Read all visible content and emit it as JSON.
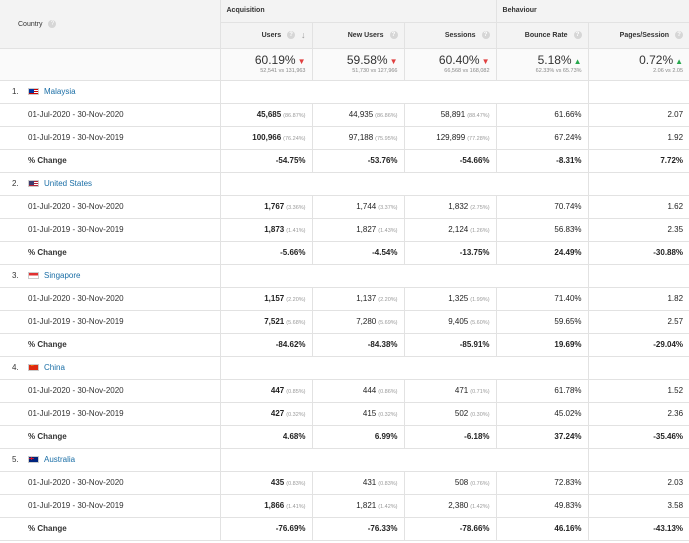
{
  "header": {
    "country_label": "Country",
    "group_acquisition": "Acquisition",
    "group_behaviour": "Behaviour",
    "columns": [
      "Users",
      "New Users",
      "Sessions",
      "Bounce Rate",
      "Pages/Session"
    ]
  },
  "totals": [
    {
      "pct": "60.19%",
      "dir": "down",
      "cmp": "52,541 vs 131,963"
    },
    {
      "pct": "59.58%",
      "dir": "down",
      "cmp": "51,730 vs 127,966"
    },
    {
      "pct": "60.40%",
      "dir": "down",
      "cmp": "66,568 vs 168,082"
    },
    {
      "pct": "5.18%",
      "dir": "up",
      "cmp": "62.33% vs 65.73%"
    },
    {
      "pct": "0.72%",
      "dir": "up",
      "cmp": "2.06 vs 2.05"
    }
  ],
  "rows": [
    {
      "index": "1.",
      "country": "Malaysia",
      "flag": "flag-my",
      "periods": [
        {
          "label": "01-Jul-2020 - 30-Nov-2020",
          "cells": [
            {
              "v": "45,685",
              "s": "(86.87%)",
              "bold": true
            },
            {
              "v": "44,935",
              "s": "(86.86%)"
            },
            {
              "v": "58,891",
              "s": "(88.47%)"
            },
            {
              "v": "61.66%"
            },
            {
              "v": "2.07"
            }
          ]
        },
        {
          "label": "01-Jul-2019 - 30-Nov-2019",
          "cells": [
            {
              "v": "100,966",
              "s": "(76.24%)",
              "bold": true
            },
            {
              "v": "97,188",
              "s": "(75.95%)"
            },
            {
              "v": "129,899",
              "s": "(77.28%)"
            },
            {
              "v": "67.24%"
            },
            {
              "v": "1.92"
            }
          ]
        }
      ],
      "change": {
        "label": "% Change",
        "cells": [
          "-54.75%",
          "-53.76%",
          "-54.66%",
          "-8.31%",
          "7.72%"
        ]
      }
    },
    {
      "index": "2.",
      "country": "United States",
      "flag": "flag-us",
      "periods": [
        {
          "label": "01-Jul-2020 - 30-Nov-2020",
          "cells": [
            {
              "v": "1,767",
              "s": "(3.36%)",
              "bold": true
            },
            {
              "v": "1,744",
              "s": "(3.37%)"
            },
            {
              "v": "1,832",
              "s": "(2.75%)"
            },
            {
              "v": "70.74%"
            },
            {
              "v": "1.62"
            }
          ]
        },
        {
          "label": "01-Jul-2019 - 30-Nov-2019",
          "cells": [
            {
              "v": "1,873",
              "s": "(1.41%)",
              "bold": true
            },
            {
              "v": "1,827",
              "s": "(1.43%)"
            },
            {
              "v": "2,124",
              "s": "(1.26%)"
            },
            {
              "v": "56.83%"
            },
            {
              "v": "2.35"
            }
          ]
        }
      ],
      "change": {
        "label": "% Change",
        "cells": [
          "-5.66%",
          "-4.54%",
          "-13.75%",
          "24.49%",
          "-30.88%"
        ]
      }
    },
    {
      "index": "3.",
      "country": "Singapore",
      "flag": "flag-sg",
      "periods": [
        {
          "label": "01-Jul-2020 - 30-Nov-2020",
          "cells": [
            {
              "v": "1,157",
              "s": "(2.20%)",
              "bold": true
            },
            {
              "v": "1,137",
              "s": "(2.20%)"
            },
            {
              "v": "1,325",
              "s": "(1.99%)"
            },
            {
              "v": "71.40%"
            },
            {
              "v": "1.82"
            }
          ]
        },
        {
          "label": "01-Jul-2019 - 30-Nov-2019",
          "cells": [
            {
              "v": "7,521",
              "s": "(5.68%)",
              "bold": true
            },
            {
              "v": "7,280",
              "s": "(5.69%)"
            },
            {
              "v": "9,405",
              "s": "(5.60%)"
            },
            {
              "v": "59.65%"
            },
            {
              "v": "2.57"
            }
          ]
        }
      ],
      "change": {
        "label": "% Change",
        "cells": [
          "-84.62%",
          "-84.38%",
          "-85.91%",
          "19.69%",
          "-29.04%"
        ]
      }
    },
    {
      "index": "4.",
      "country": "China",
      "flag": "flag-cn",
      "periods": [
        {
          "label": "01-Jul-2020 - 30-Nov-2020",
          "cells": [
            {
              "v": "447",
              "s": "(0.85%)",
              "bold": true
            },
            {
              "v": "444",
              "s": "(0.86%)"
            },
            {
              "v": "471",
              "s": "(0.71%)"
            },
            {
              "v": "61.78%"
            },
            {
              "v": "1.52"
            }
          ]
        },
        {
          "label": "01-Jul-2019 - 30-Nov-2019",
          "cells": [
            {
              "v": "427",
              "s": "(0.32%)",
              "bold": true
            },
            {
              "v": "415",
              "s": "(0.32%)"
            },
            {
              "v": "502",
              "s": "(0.30%)"
            },
            {
              "v": "45.02%"
            },
            {
              "v": "2.36"
            }
          ]
        }
      ],
      "change": {
        "label": "% Change",
        "cells": [
          "4.68%",
          "6.99%",
          "-6.18%",
          "37.24%",
          "-35.46%"
        ]
      }
    },
    {
      "index": "5.",
      "country": "Australia",
      "flag": "flag-au",
      "periods": [
        {
          "label": "01-Jul-2020 - 30-Nov-2020",
          "cells": [
            {
              "v": "435",
              "s": "(0.83%)",
              "bold": true
            },
            {
              "v": "431",
              "s": "(0.83%)"
            },
            {
              "v": "508",
              "s": "(0.76%)"
            },
            {
              "v": "72.83%"
            },
            {
              "v": "2.03"
            }
          ]
        },
        {
          "label": "01-Jul-2019 - 30-Nov-2019",
          "cells": [
            {
              "v": "1,866",
              "s": "(1.41%)",
              "bold": true
            },
            {
              "v": "1,821",
              "s": "(1.42%)"
            },
            {
              "v": "2,380",
              "s": "(1.42%)"
            },
            {
              "v": "49.83%"
            },
            {
              "v": "3.58"
            }
          ]
        }
      ],
      "change": {
        "label": "% Change",
        "cells": [
          "-76.69%",
          "-76.33%",
          "-78.66%",
          "46.16%",
          "-43.13%"
        ]
      }
    }
  ]
}
